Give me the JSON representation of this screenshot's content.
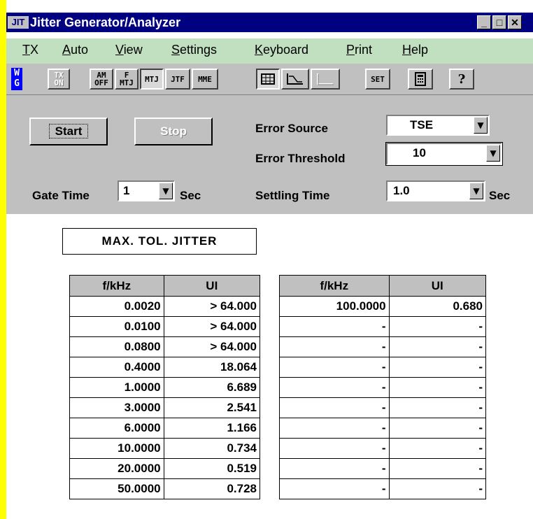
{
  "window": {
    "logo": "JIT",
    "title": "Jitter Generator/Analyzer",
    "controls": [
      "_",
      "□",
      "✕"
    ]
  },
  "menu": {
    "items": [
      {
        "mn": "T",
        "rest": "X"
      },
      {
        "mn": "A",
        "rest": "uto"
      },
      {
        "mn": "V",
        "rest": "iew"
      },
      {
        "mn": "S",
        "rest": "ettings"
      },
      {
        "mn": "K",
        "rest": "eyboard"
      },
      {
        "mn": "P",
        "rest": "rint"
      },
      {
        "mn": "H",
        "rest": "elp"
      }
    ]
  },
  "toolbar": {
    "wg_line1": "W",
    "wg_line2": "G",
    "tx_on_line1": "TX",
    "tx_on_line2": "ON",
    "am_off_line1": "AM",
    "am_off_line2": "OFF",
    "f_mtj_line1": "F",
    "f_mtj_line2": "MTJ",
    "mtj": "MTJ",
    "jtf": "JTF",
    "mme": "MME",
    "set": "SET",
    "help": "?"
  },
  "controls": {
    "start_label": "Start",
    "stop_label": "Stop",
    "error_source_label": "Error Source",
    "error_source_value": "TSE",
    "error_threshold_label": "Error Threshold",
    "error_threshold_value": "10",
    "gate_time_label": "Gate Time",
    "gate_time_value": "1",
    "gate_time_unit": "Sec",
    "settling_time_label": "Settling Time",
    "settling_time_value": "1.0",
    "settling_time_unit": "Sec"
  },
  "results": {
    "heading": "MAX. TOL. JITTER",
    "col_freq": "f/kHz",
    "col_ui": "UI",
    "left_rows": [
      {
        "f": "0.0020",
        "ui": "> 64.000"
      },
      {
        "f": "0.0100",
        "ui": "> 64.000"
      },
      {
        "f": "0.0800",
        "ui": "> 64.000"
      },
      {
        "f": "0.4000",
        "ui": "18.064"
      },
      {
        "f": "1.0000",
        "ui": "6.689"
      },
      {
        "f": "3.0000",
        "ui": "2.541"
      },
      {
        "f": "6.0000",
        "ui": "1.166"
      },
      {
        "f": "10.0000",
        "ui": "0.734"
      },
      {
        "f": "20.0000",
        "ui": "0.519"
      },
      {
        "f": "50.0000",
        "ui": "0.728"
      }
    ],
    "right_rows": [
      {
        "f": "100.0000",
        "ui": "0.680"
      },
      {
        "f": "-",
        "ui": "-"
      },
      {
        "f": "-",
        "ui": "-"
      },
      {
        "f": "-",
        "ui": "-"
      },
      {
        "f": "-",
        "ui": "-"
      },
      {
        "f": "-",
        "ui": "-"
      },
      {
        "f": "-",
        "ui": "-"
      },
      {
        "f": "-",
        "ui": "-"
      },
      {
        "f": "-",
        "ui": "-"
      },
      {
        "f": "-",
        "ui": "-"
      }
    ]
  },
  "colors": {
    "title_bar": "#000080",
    "menu_bar": "#c0e0c0",
    "face": "#c0c0c0",
    "left_strip": "#ffff00"
  }
}
